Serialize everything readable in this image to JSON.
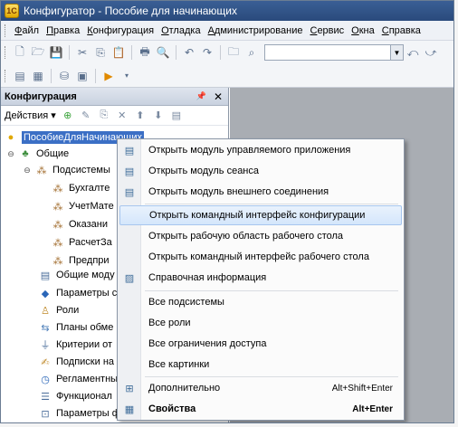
{
  "window": {
    "title": "Конфигуратор - Пособие для начинающих"
  },
  "menubar": {
    "items": [
      "Файл",
      "Правка",
      "Конфигурация",
      "Отладка",
      "Администрирование",
      "Сервис",
      "Окна",
      "Справка"
    ]
  },
  "panel": {
    "title": "Конфигурация",
    "actions_label": "Действия ▾",
    "tree": {
      "root": "ПособиеДляНачинающих",
      "common": "Общие",
      "subsystems": "Подсистемы",
      "subsystem_items": [
        "Бухгалте",
        "УчетМате",
        "Оказани",
        "РасчетЗа",
        "Предпри"
      ],
      "items": [
        "Общие моду",
        "Параметры с",
        "Роли",
        "Планы обме",
        "Критерии от",
        "Подписки на",
        "Регламентны",
        "Функционал",
        "Параметры ф"
      ]
    }
  },
  "context_menu": {
    "items": [
      "Открыть модуль управляемого приложения",
      "Открыть модуль сеанса",
      "Открыть модуль внешнего соединения",
      "Открыть командный интерфейс конфигурации",
      "Открыть рабочую область рабочего стола",
      "Открыть командный интерфейс рабочего стола",
      "Справочная информация",
      "Все подсистемы",
      "Все роли",
      "Все ограничения доступа",
      "Все картинки",
      "Дополнительно",
      "Свойства"
    ],
    "shortcuts": {
      "more": "Alt+Shift+Enter",
      "properties": "Alt+Enter"
    }
  }
}
